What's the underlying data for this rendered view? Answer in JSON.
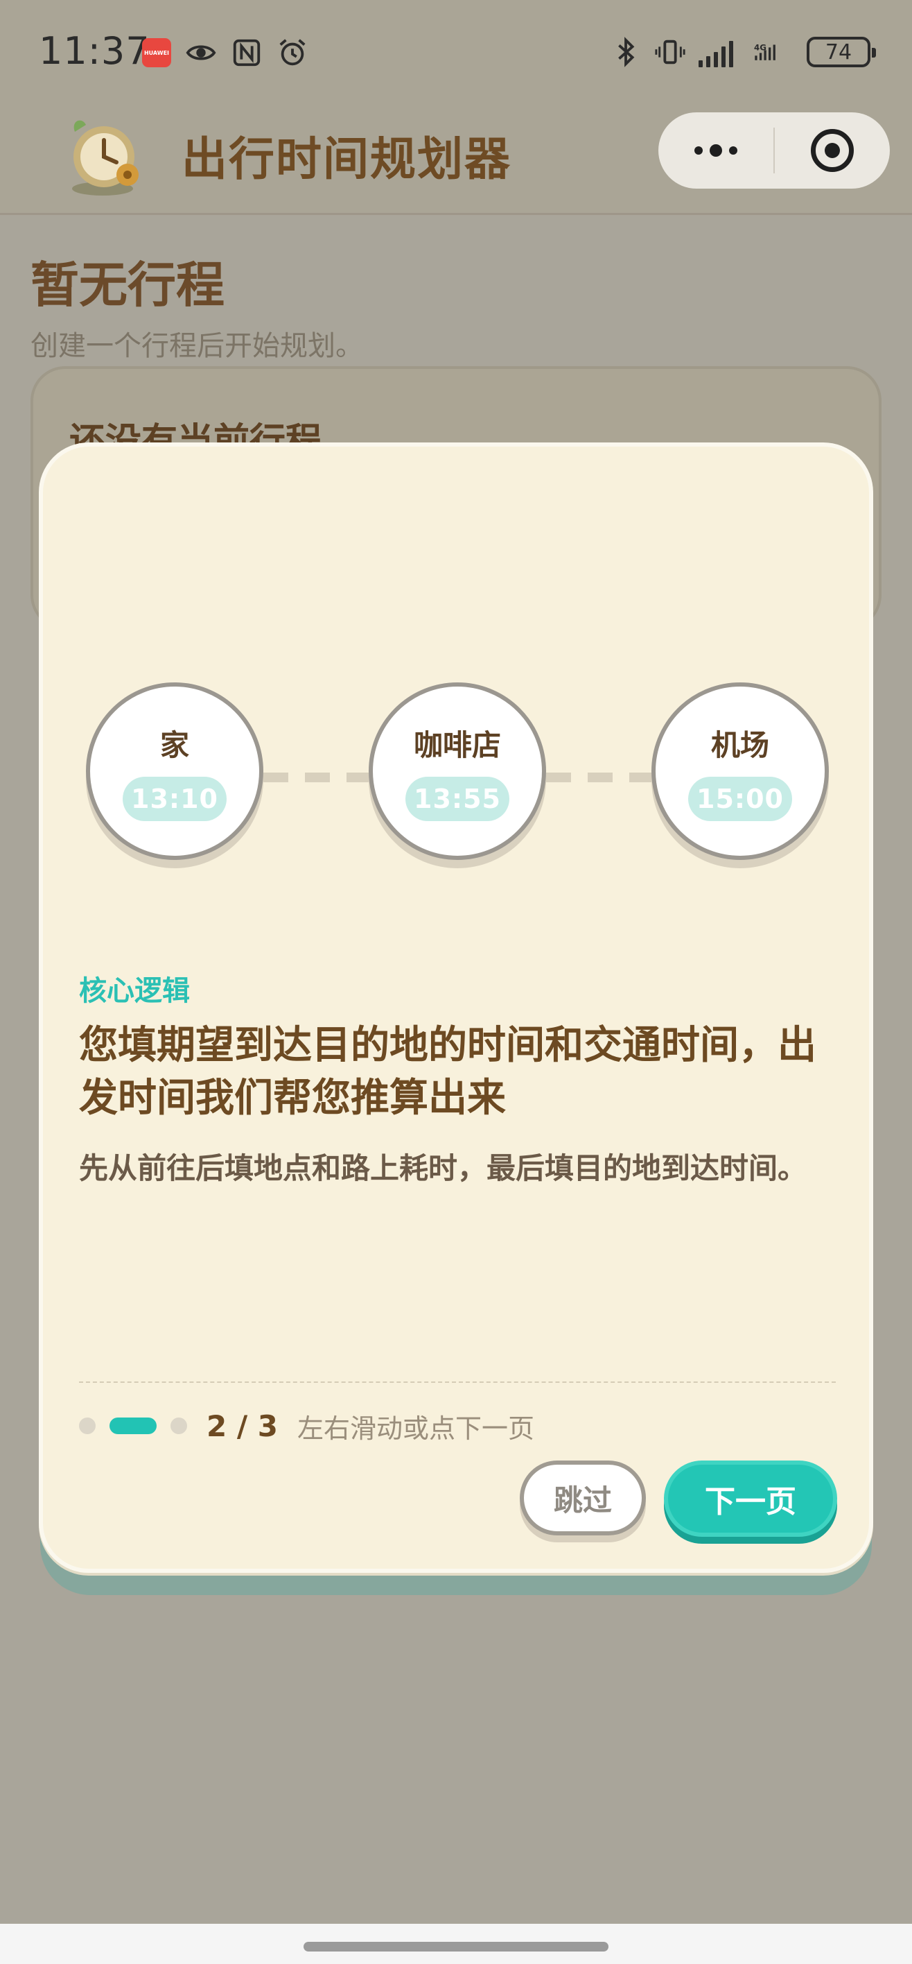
{
  "status_bar": {
    "time": "11:37",
    "app_badge_text": "HUAWEI",
    "left_icons": [
      "huawei-app-icon",
      "eye-icon",
      "nfc-icon",
      "alarm-icon"
    ],
    "right_icons": [
      "bluetooth-icon",
      "vibrate-icon",
      "signal-icon",
      "4g-signal-icon",
      "battery-icon"
    ],
    "network_type": "4G",
    "battery_level": "74"
  },
  "header": {
    "title": "出行时间规划器",
    "logo_icon": "clock-logo-icon",
    "more_icon": "more-dots-icon",
    "close_icon": "target-close-icon"
  },
  "page": {
    "title": "暂无行程",
    "subtitle": "创建一个行程后开始规划。",
    "empty_card_title": "还没有当前行程"
  },
  "modal": {
    "route": [
      {
        "name": "家",
        "time": "13:10"
      },
      {
        "name": "咖啡店",
        "time": "13:55"
      },
      {
        "name": "机场",
        "time": "15:00"
      }
    ],
    "core_label": "核心逻辑",
    "headline": "您填期望到达目的地的时间和交通时间，出发时间我们帮您推算出来",
    "description": "先从前往后填地点和路上耗时，最后填目的地到达时间。",
    "pager": {
      "current": 2,
      "total": 3,
      "count_text": "2 / 3",
      "hint": "左右滑动或点下一页"
    },
    "skip_label": "跳过",
    "next_label": "下一页"
  },
  "colors": {
    "accent": "#23c6b5",
    "title_brown": "#6d4a22",
    "modal_bg": "#f8f1dc",
    "overlay": "#a9a59a"
  }
}
